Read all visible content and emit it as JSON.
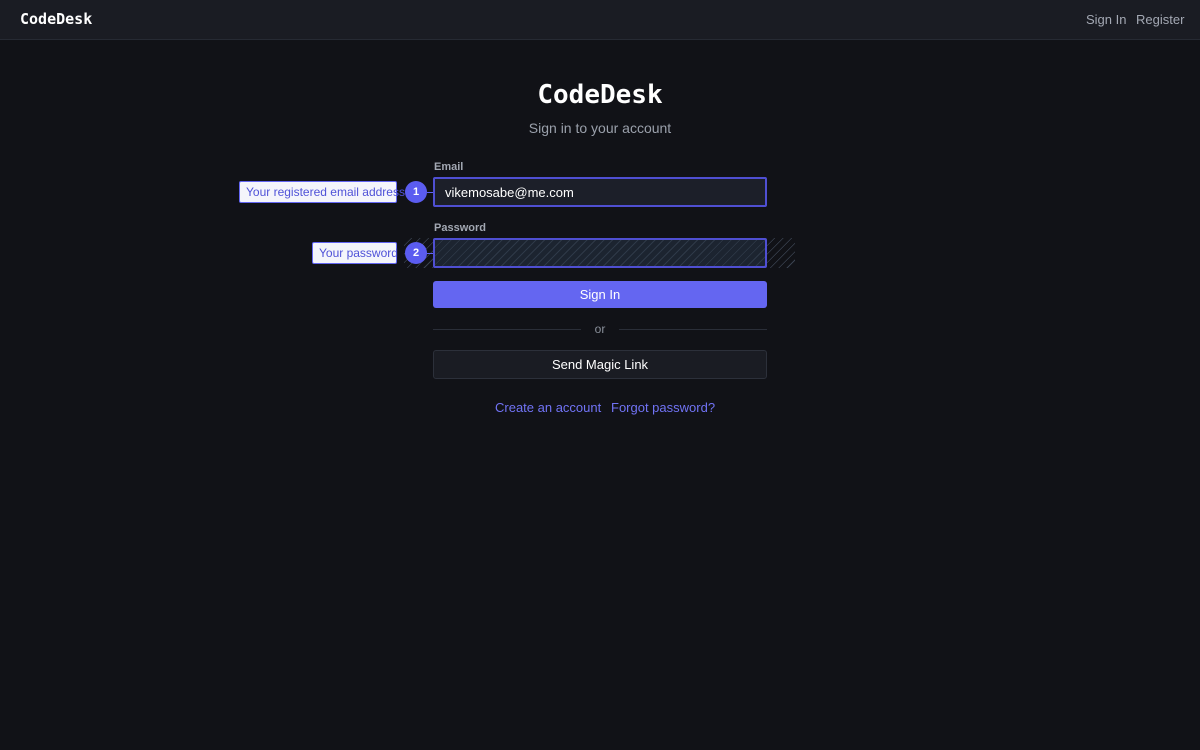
{
  "nav": {
    "brand": "CodeDesk",
    "sign_in": "Sign In",
    "register": "Register"
  },
  "header": {
    "title": "CodeDesk",
    "subtitle": "Sign in to your account"
  },
  "form": {
    "email": {
      "label": "Email",
      "value": "vikemosabe@me.com",
      "hint": "Your registered email address",
      "badge": "1"
    },
    "password": {
      "label": "Password",
      "value": "",
      "hint": "Your password",
      "badge": "2"
    },
    "submit_label": "Sign In",
    "divider_text": "or",
    "magic_link_label": "Send Magic Link"
  },
  "links": {
    "create_account": "Create an account",
    "forgot_password": "Forgot password?"
  },
  "colors": {
    "accent": "#6466f1",
    "background": "#111217",
    "link": "#7173f5"
  }
}
